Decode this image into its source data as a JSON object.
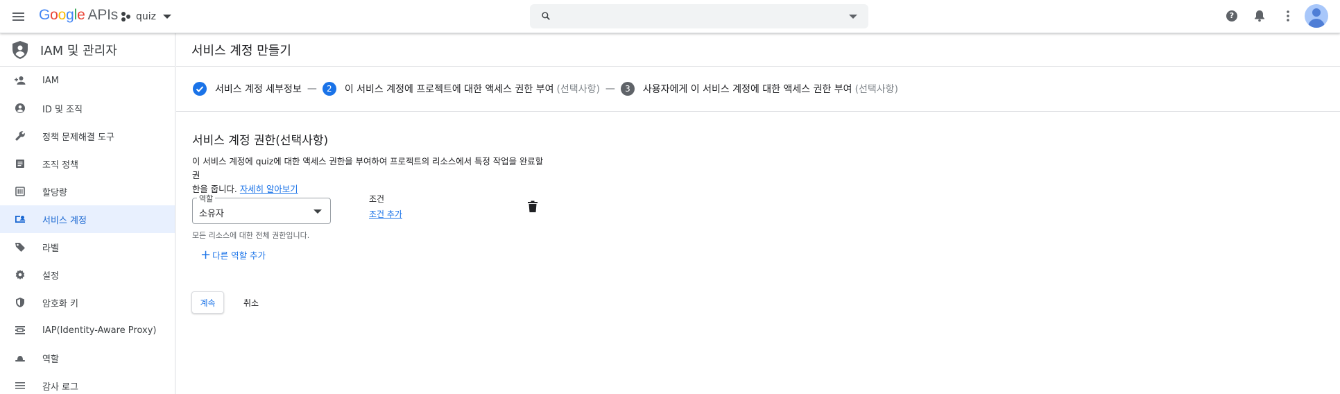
{
  "topbar": {
    "logo_google": "Google",
    "logo_apis": "APIs",
    "project_name": "quiz",
    "search_placeholder": ""
  },
  "sidebar": {
    "title": "IAM 및 관리자",
    "items": [
      {
        "label": "IAM",
        "icon": "person-add-icon"
      },
      {
        "label": "ID 및 조직",
        "icon": "account-circle-icon"
      },
      {
        "label": "정책 문제해결 도구",
        "icon": "wrench-icon"
      },
      {
        "label": "조직 정책",
        "icon": "document-icon"
      },
      {
        "label": "할당량",
        "icon": "quota-icon"
      },
      {
        "label": "서비스 계정",
        "icon": "service-account-icon",
        "active": true
      },
      {
        "label": "라벨",
        "icon": "label-icon"
      },
      {
        "label": "설정",
        "icon": "gear-icon"
      },
      {
        "label": "암호화 키",
        "icon": "encryption-shield-icon"
      },
      {
        "label": "IAP(Identity-Aware Proxy)",
        "icon": "iap-icon"
      },
      {
        "label": "역할",
        "icon": "hat-icon"
      },
      {
        "label": "감사 로그",
        "icon": "list-icon"
      }
    ]
  },
  "main": {
    "page_title": "서비스 계정 만들기",
    "steps": [
      {
        "label": "서비스 계정 세부정보",
        "badge": "✓",
        "optional": ""
      },
      {
        "label": "이 서비스 계정에 프로젝트에 대한 액세스 권한 부여",
        "badge": "2",
        "optional": "(선택사항)"
      },
      {
        "label": "사용자에게 이 서비스 계정에 대한 액세스 권한 부여",
        "badge": "3",
        "optional": "(선택사항)"
      }
    ],
    "step_separator": "—",
    "section_title": "서비스 계정 권한(선택사항)",
    "description_line1": "이 서비스 계정에 quiz에 대한 액세스 권한을 부여하여 프로젝트의 리소스에서 특정 작업을 완료할 권",
    "description_line2": "한을 줍니다.",
    "learn_more": "자세히 알아보기",
    "role_label": "역할",
    "role_value": "소유자",
    "role_hint": "모든 리소스에 대한 전체 권한입니다.",
    "condition_label": "조건",
    "add_condition": "조건 추가",
    "add_role_plus": "+",
    "add_role": "다른 역할 추가",
    "continue_label": "계속",
    "cancel_label": "취소"
  },
  "colors": {
    "accent": "#1a73e8",
    "active_bg": "#e8f0fe",
    "border": "#dadce0"
  }
}
